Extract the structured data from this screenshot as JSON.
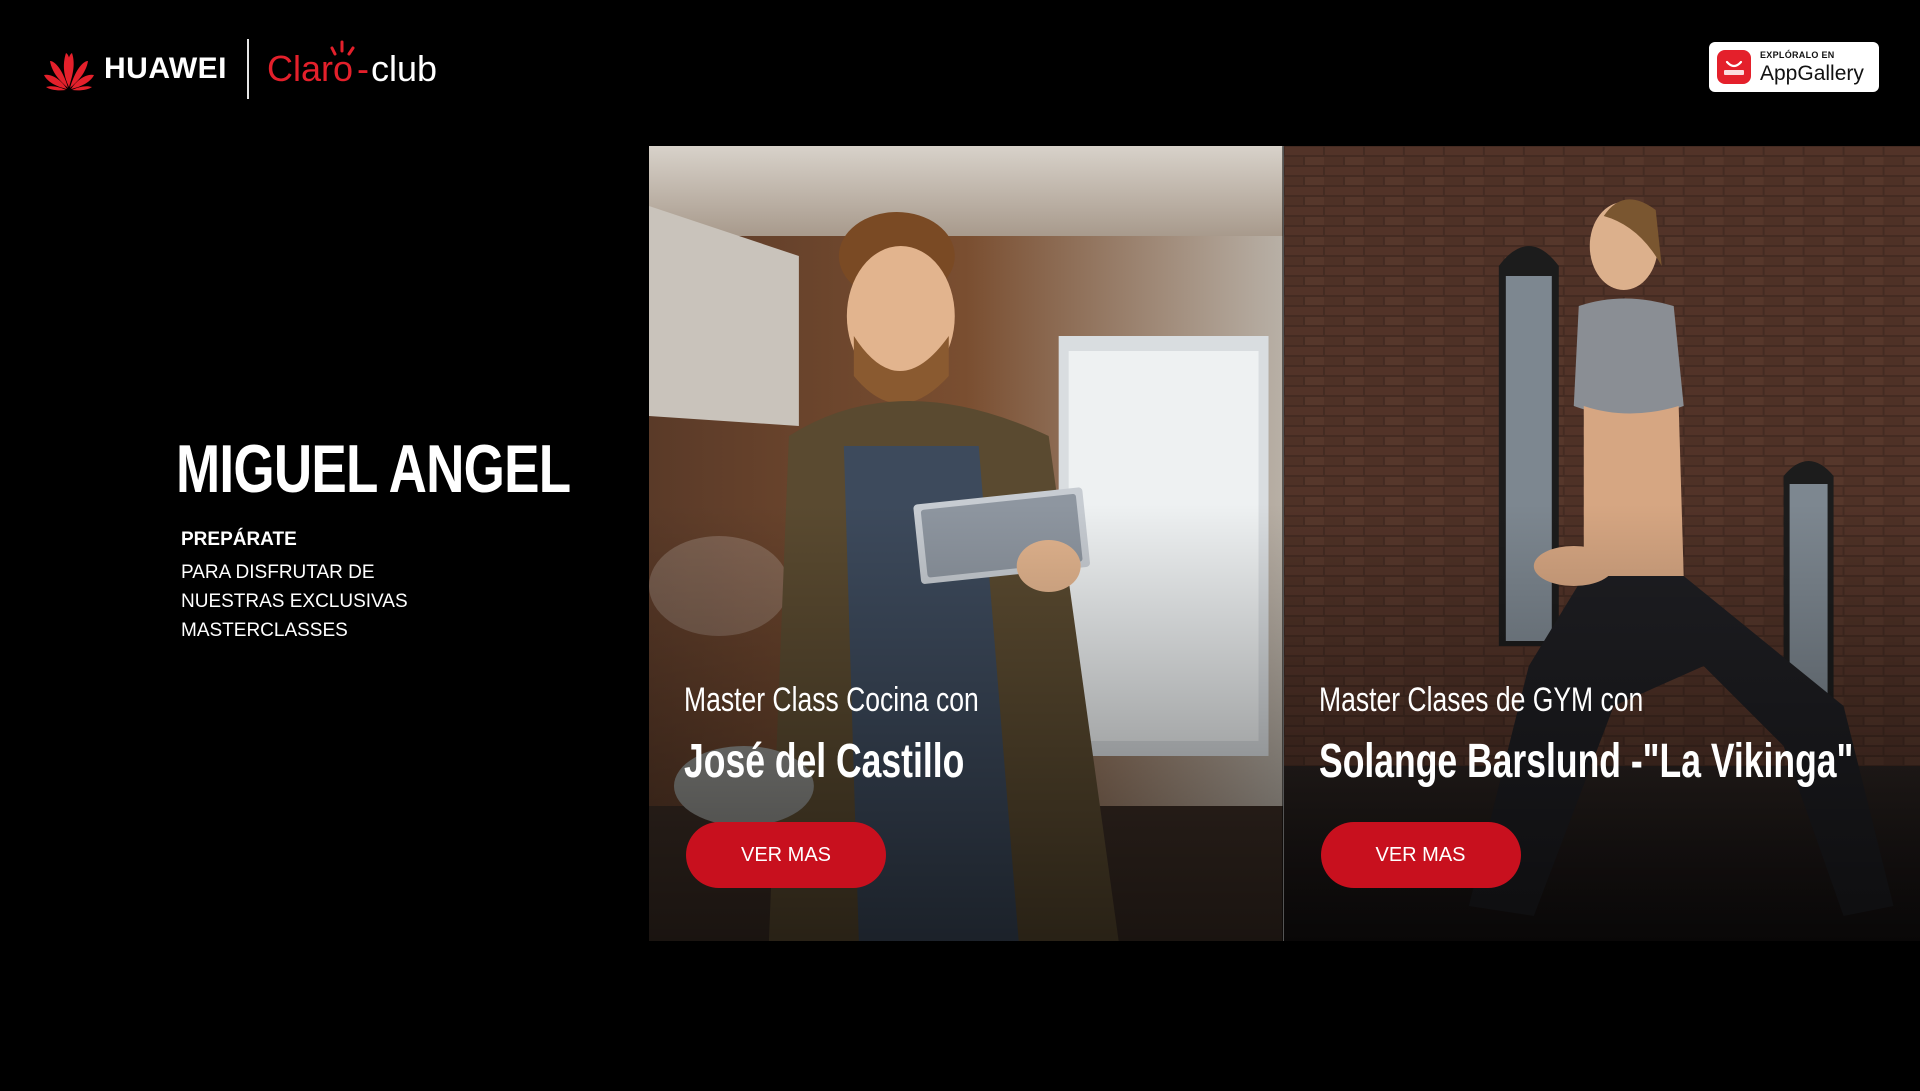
{
  "header": {
    "huawei": "HUAWEI",
    "claro": "Claro",
    "club": "club",
    "appgallery_small": "EXPLÓRALO EN",
    "appgallery_big": "AppGallery"
  },
  "intro": {
    "title": "MIGUEL ANGEL",
    "lead": "PREPÁRATE",
    "lines": [
      "PARA DISFRUTAR DE",
      "NUESTRAS EXCLUSIVAS",
      "MASTERCLASSES"
    ]
  },
  "cards": [
    {
      "subtitle": "Master Class Cocina con",
      "name": "José del Castillo",
      "button": "VER MAS"
    },
    {
      "subtitle": "Master Clases de GYM con",
      "name": "Solange Barslund -\"La Vikinga\"",
      "button": "VER MAS"
    }
  ],
  "colors": {
    "claro_red": "#e4202b",
    "button_red": "#c8101e",
    "background": "#000000"
  }
}
